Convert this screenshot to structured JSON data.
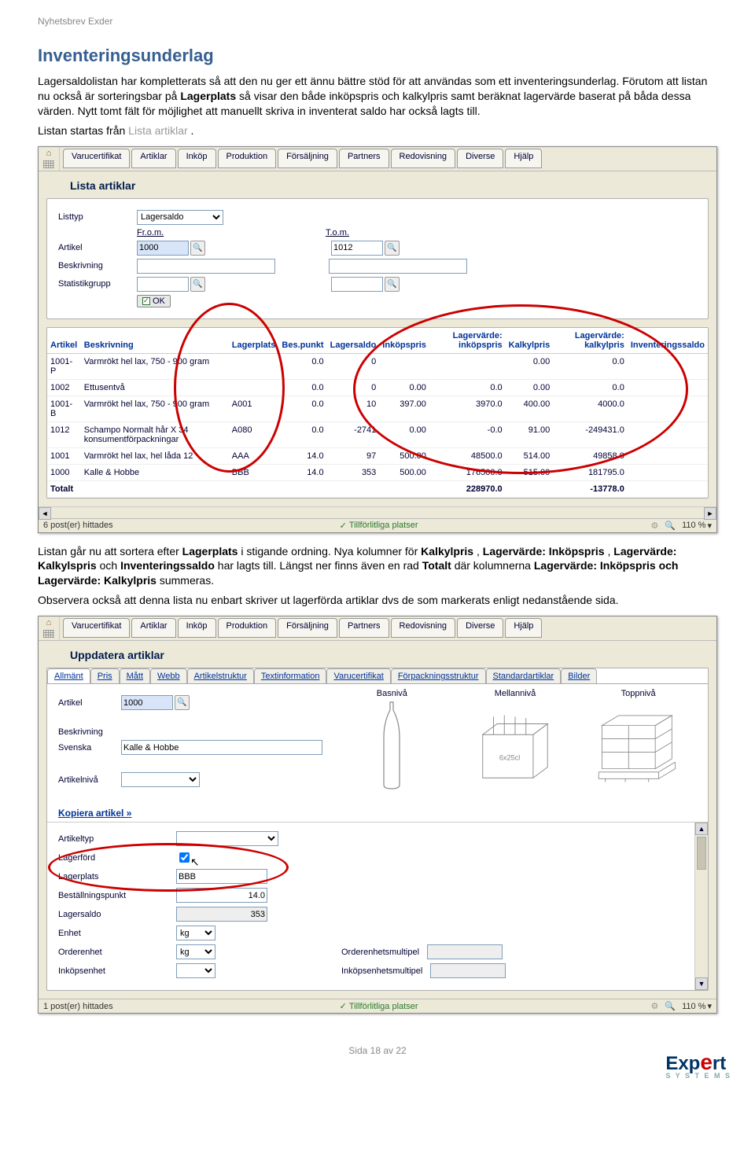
{
  "header": {
    "small": "Nyhetsbrev Exder"
  },
  "doc": {
    "h2": "Inventeringsunderlag",
    "p1": "Lagersaldolistan har kompletterats så att den nu ger ett ännu bättre stöd för att användas som ett inventeringsunderlag. Förutom att listan nu också är sorteringsbar på ",
    "p1b": "Lagerplats",
    "p1c": " så visar den både inköpspris och kalkylpris samt beräknat lagervärde baserat på båda dessa värden. Nytt tomt fält för möjlighet att manuellt skriva in inventerat saldo har också lagts till.",
    "p2a": "Listan startas från ",
    "p2b": "Lista artiklar",
    "p2c": ".",
    "p3a": "Listan går nu att sortera efter ",
    "p3kw1": "Lagerplats",
    "p3b": " i stigande ordning. Nya kolumner för ",
    "p3kw2": "Kalkylpris",
    "p3c": ", ",
    "p3kw3": "Lagervärde: Inköpspris",
    "p3d": ", ",
    "p3kw4": "Lagervärde: Kalkylspris",
    "p3e": " och ",
    "p3kw5": "Inventeringssaldo",
    "p3f": " har lagts till. Längst ner finns även en rad ",
    "p3kw6": "Totalt",
    "p3g": " där kolumnerna ",
    "p3kw7": "Lagervärde: Inköpspris och Lagervärde: Kalkylpris",
    "p3h": " summeras.",
    "p4": "Observera också att denna lista nu enbart skriver ut lagerförda artiklar dvs de som markerats enligt nedanstående sida."
  },
  "menu": [
    "Varucertifikat",
    "Artiklar",
    "Inköp",
    "Produktion",
    "Försäljning",
    "Partners",
    "Redovisning",
    "Diverse",
    "Hjälp"
  ],
  "ss1": {
    "title": "Lista artiklar",
    "listtyp_lbl": "Listtyp",
    "listtyp_val": "Lagersaldo",
    "from_lbl": "Fr.o.m.",
    "to_lbl": "T.o.m.",
    "artikel_lbl": "Artikel",
    "artikel_from": "1000",
    "artikel_to": "1012",
    "beskr_lbl": "Beskrivning",
    "stat_lbl": "Statistikgrupp",
    "ok": "OK",
    "cols": [
      "Artikel",
      "Beskrivning",
      "Lagerplats",
      "Bes.punkt",
      "Lagersaldo",
      "Inköpspris",
      "Lagervärde: inköpspris",
      "Kalkylpris",
      "Lagervärde: kalkylpris",
      "Inventeringssaldo"
    ],
    "rows": [
      {
        "art": "1001-P",
        "beskr": "Varmrökt hel lax, 750 - 900 gram",
        "lp": "",
        "bp": "0.0",
        "ls": "0",
        "ip": "",
        "lvi": "",
        "kp": "0.00",
        "lvk": "0.0",
        "inv": ""
      },
      {
        "art": "1002",
        "beskr": "Ettusentvå",
        "lp": "",
        "bp": "0.0",
        "ls": "0",
        "ip": "0.00",
        "lvi": "0.0",
        "kp": "0.00",
        "lvk": "0.0",
        "inv": ""
      },
      {
        "art": "1001-B",
        "beskr": "Varmrökt hel lax, 750 - 900 gram",
        "lp": "A001",
        "bp": "0.0",
        "ls": "10",
        "ip": "397.00",
        "lvi": "3970.0",
        "kp": "400.00",
        "lvk": "4000.0",
        "inv": ""
      },
      {
        "art": "1012",
        "beskr": "Schampo Normalt hår X 34 konsumentförpackningar",
        "lp": "A080",
        "bp": "0.0",
        "ls": "-2741",
        "ip": "0.00",
        "lvi": "-0.0",
        "kp": "91.00",
        "lvk": "-249431.0",
        "inv": ""
      },
      {
        "art": "1001",
        "beskr": "Varmrökt hel lax, hel låda 12",
        "lp": "AAA",
        "bp": "14.0",
        "ls": "97",
        "ip": "500.00",
        "lvi": "48500.0",
        "kp": "514.00",
        "lvk": "49858.0",
        "inv": ""
      },
      {
        "art": "1000",
        "beskr": "Kalle & Hobbe",
        "lp": "BBB",
        "bp": "14.0",
        "ls": "353",
        "ip": "500.00",
        "lvi": "176500.0",
        "kp": "515.00",
        "lvk": "181795.0",
        "inv": ""
      }
    ],
    "tot_lbl": "Totalt",
    "tot_lvi": "228970.0",
    "tot_lvk": "-13778.0",
    "status": "6 post(er) hittades",
    "trust": "Tillförlitliga platser",
    "zoom": "110 %"
  },
  "ss2": {
    "title": "Uppdatera artiklar",
    "subtabs": [
      "Allmänt",
      "Pris",
      "Mått",
      "Webb",
      "Artikelstruktur",
      "Textinformation",
      "Varucertifikat",
      "Förpackningsstruktur",
      "Standardartiklar",
      "Bilder"
    ],
    "artikel_lbl": "Artikel",
    "artikel_val": "1000",
    "basniva": "Basnivå",
    "mellanniva": "Mellannivå",
    "toppniva": "Toppnivå",
    "beskr_lbl": "Beskrivning",
    "svenska_lbl": "Svenska",
    "svenska_val": "Kalle & Hobbe",
    "artniva_lbl": "Artikelnivå",
    "kopiera": "Kopiera artikel »",
    "fields": {
      "artikeltyp": "Artikeltyp",
      "lagerford": "Lagerförd",
      "lagerplats": "Lagerplats",
      "lagerplats_val": "BBB",
      "bestpunkt": "Beställningspunkt",
      "bestpunkt_val": "14.0",
      "lagersaldo": "Lagersaldo",
      "lagersaldo_val": "353",
      "enhet": "Enhet",
      "enhet_val": "kg",
      "orderenhet": "Orderenhet",
      "orderenhet_val": "kg",
      "inkopsenhet": "Inköpsenhet",
      "orderenhetsmultipel": "Orderenhetsmultipel",
      "inkopsenhetsmultipel": "Inköpsenhetsmultipel"
    },
    "status": "1 post(er) hittades",
    "trust": "Tillförlitliga platser",
    "zoom": "110 %"
  },
  "footer": {
    "page": "Sida 18 av 22"
  }
}
